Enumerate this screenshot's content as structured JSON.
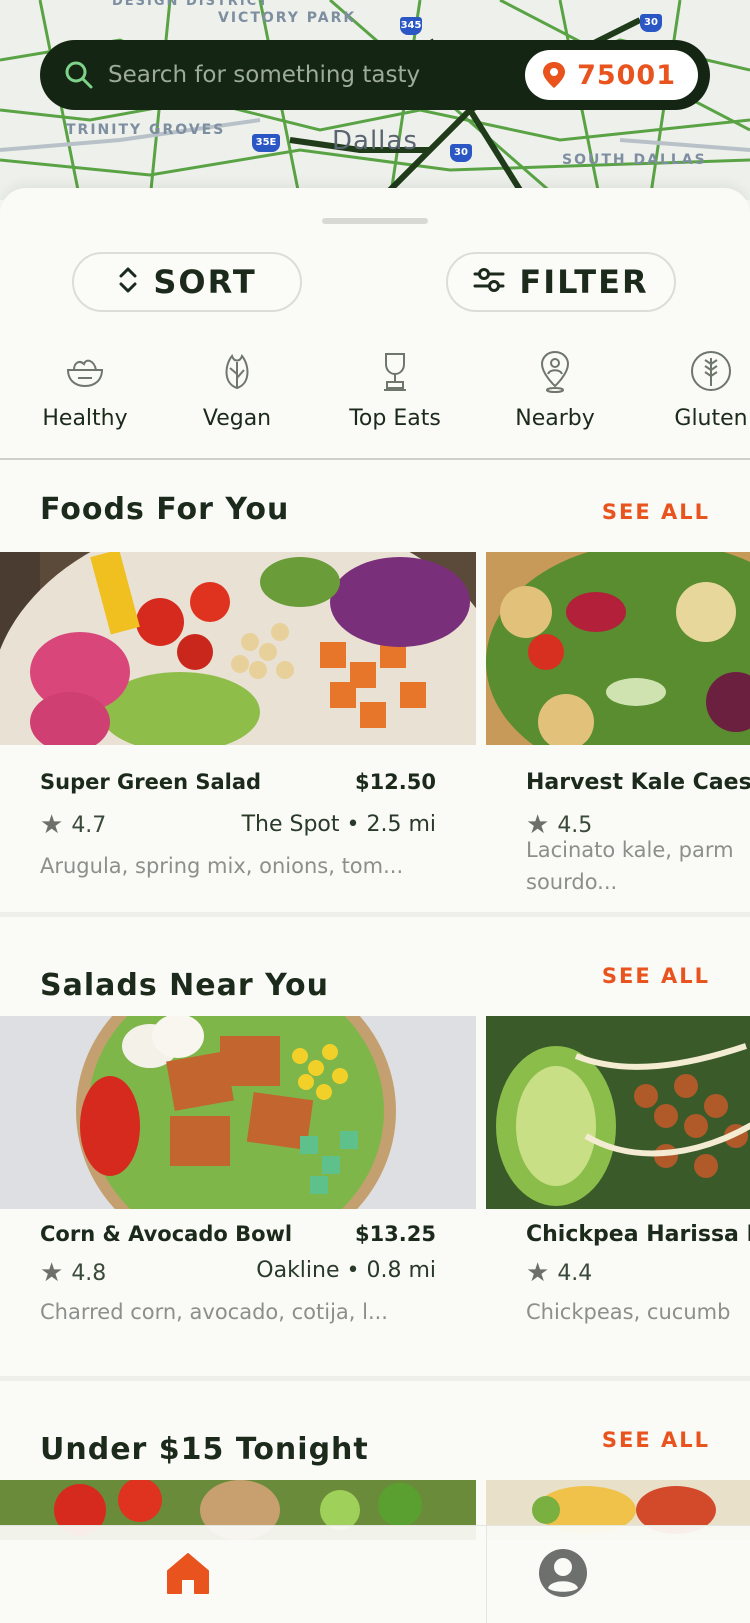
{
  "map": {
    "labels": [
      "DESIGN DISTRICT",
      "VICTORY PARK",
      "TRINITY GROVES",
      "SOUTH DALLAS"
    ],
    "city": "Dallas",
    "shields": [
      "345",
      "30",
      "35E",
      "30"
    ]
  },
  "search": {
    "placeholder": "Search for something tasty",
    "zip": "75001"
  },
  "controls": {
    "sort_label": "SORT",
    "filter_label": "FILTER"
  },
  "categories": [
    {
      "label": "Healthy",
      "icon": "salad-bowl-icon"
    },
    {
      "label": "Vegan",
      "icon": "leaf-icon"
    },
    {
      "label": "Top Eats",
      "icon": "trophy-icon"
    },
    {
      "label": "Nearby",
      "icon": "location-pin-icon"
    },
    {
      "label": "Gluten",
      "icon": "wheat-icon"
    }
  ],
  "sections": [
    {
      "title": "Foods For You",
      "see_all": "SEE ALL",
      "cards": [
        {
          "name": "Super Green Salad",
          "price": "$12.50",
          "rating": "4.7",
          "place": "The Spot • 2.5 mi",
          "desc": "Arugula, spring mix, onions, tom..."
        },
        {
          "name": "Harvest Kale Caesa",
          "rating": "4.5",
          "desc_line1": "Lacinato kale, parm",
          "desc_line2": "sourdo..."
        }
      ]
    },
    {
      "title": "Salads Near You",
      "see_all": "SEE ALL",
      "cards": [
        {
          "name": "Corn & Avocado Bowl",
          "price": "$13.25",
          "rating": "4.8",
          "place": "Oakline • 0.8 mi",
          "desc": "Charred corn, avocado, cotija, l..."
        },
        {
          "name": "Chickpea Harissa B",
          "rating": "4.4",
          "desc": "Chickpeas, cucumb"
        }
      ]
    },
    {
      "title": "Under $15 Tonight",
      "see_all": "SEE ALL"
    }
  ],
  "nav": {
    "tabs": [
      {
        "name": "home",
        "icon": "home-icon",
        "active": true
      },
      {
        "name": "profile",
        "icon": "profile-icon",
        "active": false
      }
    ]
  },
  "colors": {
    "accent": "#e8531e",
    "dark_green": "#142613",
    "map_road": "#4e9a3a"
  }
}
